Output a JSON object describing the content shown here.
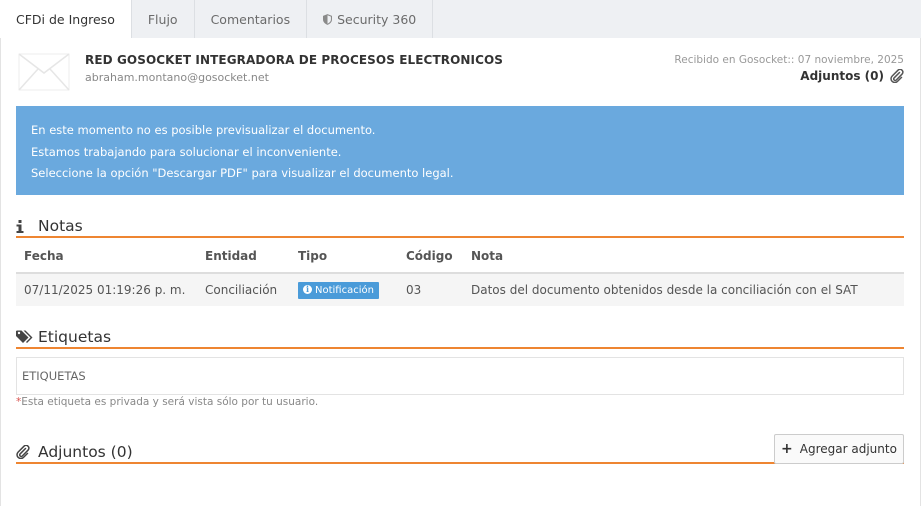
{
  "tabs": [
    {
      "label": "CFDi de Ingreso",
      "active": true
    },
    {
      "label": "Flujo",
      "active": false
    },
    {
      "label": "Comentarios",
      "active": false
    },
    {
      "label": "Security 360",
      "active": false
    }
  ],
  "header": {
    "sender": "RED GOSOCKET INTEGRADORA DE PROCESOS ELECTRONICOS",
    "email": "abraham.montano@gosocket.net",
    "received": "Recibido en Gosocket:: 07 noviembre, 2025",
    "attachments_label": "Adjuntos (0)"
  },
  "alert": {
    "lines": [
      "En este momento no es posible previsualizar el documento.",
      "Estamos trabajando para solucionar el inconveniente.",
      "Seleccione la opción \"Descargar PDF\" para visualizar el documento legal."
    ]
  },
  "notes": {
    "title": "Notas",
    "columns": [
      "Fecha",
      "Entidad",
      "Tipo",
      "Código",
      "Nota"
    ],
    "rows": [
      {
        "fecha": "07/11/2025 01:19:26 p. m.",
        "entidad": "Conciliación",
        "tipo": "Notificación",
        "codigo": "03",
        "nota": "Datos del documento obtenidos desde la conciliación con el SAT"
      }
    ]
  },
  "tags": {
    "title": "Etiquetas",
    "placeholder": "ETIQUETAS",
    "note_star": "*",
    "note": "Esta etiqueta es privada y será vista sólo por tu usuario."
  },
  "attachments": {
    "title": "Adjuntos (0)",
    "add_button": "Agregar adjunto"
  },
  "colors": {
    "accent_orange": "#ee8531",
    "alert_blue": "#6aa9de",
    "badge_blue": "#4a9bd9",
    "tab_bar": "#eef0f3"
  }
}
